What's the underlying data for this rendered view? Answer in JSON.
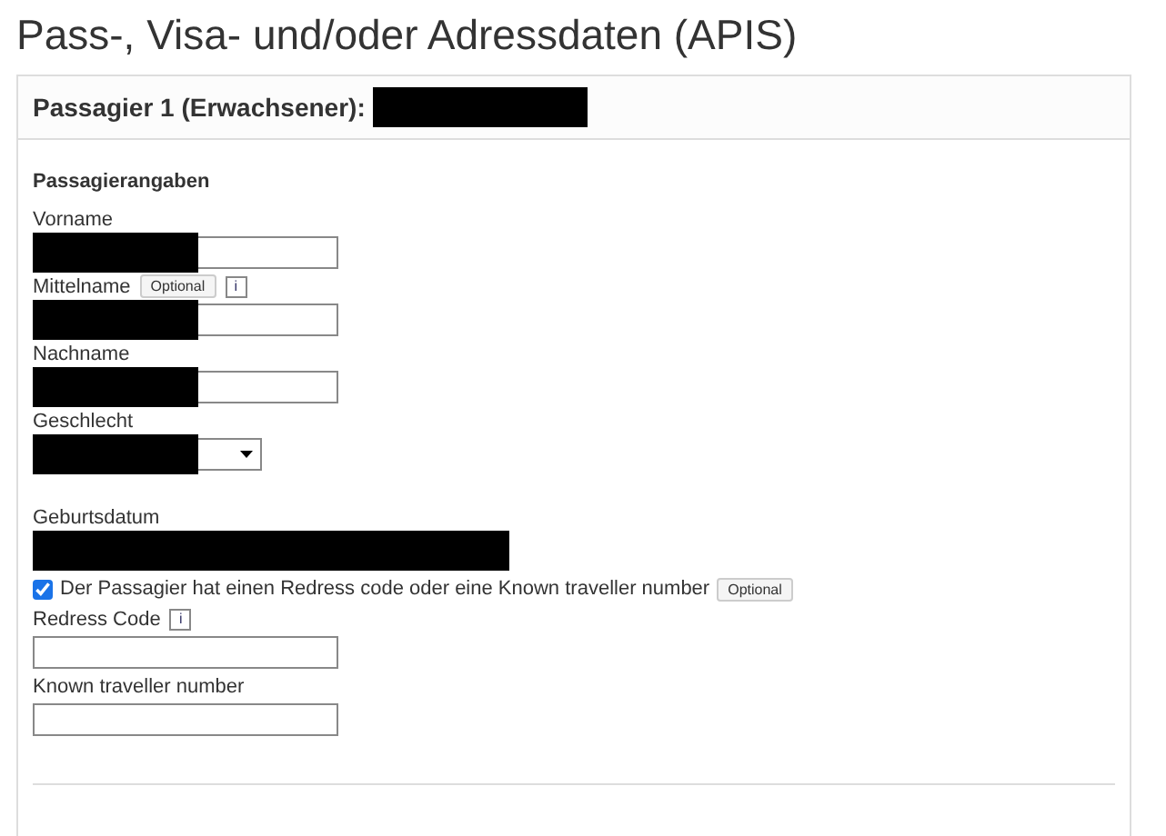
{
  "page_title": "Pass-, Visa- und/oder Adressdaten (APIS)",
  "card": {
    "title": "Passagier 1 (Erwachsener):",
    "title_redacted": true,
    "section": "Passagierangaben",
    "fields": [
      {
        "kind": "text",
        "label": "Vorname",
        "redacted": true
      },
      {
        "kind": "text",
        "label": "Mittelname",
        "optional": "Optional",
        "info": "i",
        "redacted": true
      },
      {
        "kind": "text",
        "label": "Nachname",
        "redacted": true
      },
      {
        "kind": "select",
        "label": "Geschlecht",
        "redacted": true
      },
      {
        "kind": "date",
        "label": "Geburtsdatum",
        "redacted": true
      },
      {
        "kind": "checkbox",
        "label": "Der Passagier hat einen Redress code oder eine Known traveller number",
        "checked": true,
        "optional": "Optional"
      },
      {
        "kind": "text",
        "label": "Redress Code",
        "info": "i"
      },
      {
        "kind": "text",
        "label": "Known traveller number"
      }
    ]
  }
}
